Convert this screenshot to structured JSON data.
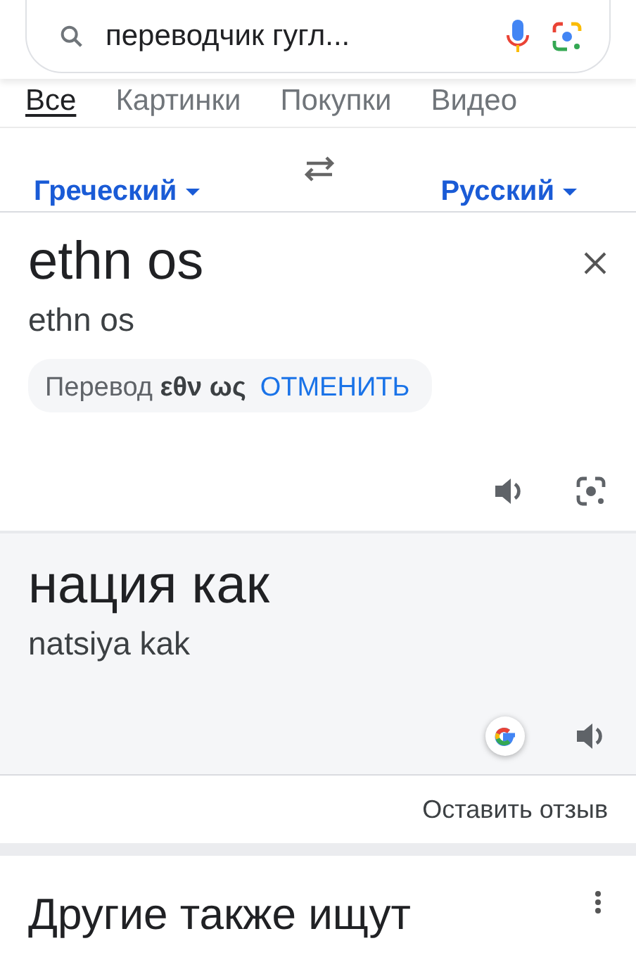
{
  "search": {
    "value": "переводчик гугл..."
  },
  "tabs": [
    {
      "label": "Все",
      "selected": true
    },
    {
      "label": "Картинки",
      "selected": false
    },
    {
      "label": "Покупки",
      "selected": false
    },
    {
      "label": "Видео",
      "selected": false
    }
  ],
  "languages": {
    "source": "Греческий",
    "target": "Русский"
  },
  "input": {
    "text": "ethn os",
    "transliteration": "ethn os",
    "suggestion": {
      "label": "Перевод",
      "value": "εθν ως",
      "action": "ОТМЕНИТЬ"
    }
  },
  "output": {
    "text": "нация как",
    "transliteration": "natsiya kak"
  },
  "feedback": "Оставить отзыв",
  "related": {
    "title": "Другие также ищут"
  }
}
